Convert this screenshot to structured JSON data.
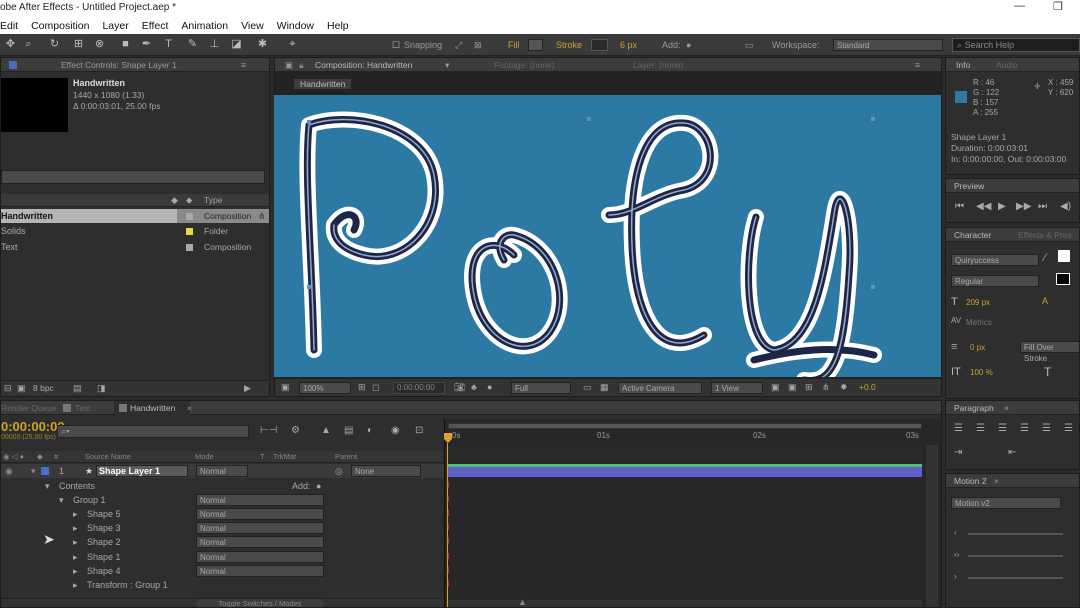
{
  "titlebar": {
    "title": "obe After Effects - Untitled Project.aep *"
  },
  "menu": [
    "Edit",
    "Composition",
    "Layer",
    "Effect",
    "Animation",
    "View",
    "Window",
    "Help"
  ],
  "toolbar": {
    "snapping": "Snapping",
    "fill": "Fill",
    "stroke": "Stroke",
    "stroke_px": "6 px",
    "add": "Add:",
    "workspace_label": "Workspace:",
    "workspace_value": "Standard",
    "search_placeholder": "Search Help"
  },
  "project": {
    "effect_tab": "Effect Controls: Shape Layer 1",
    "comp_name": "Handwritten",
    "comp_res": "1440 x 1080 (1.33)",
    "comp_duration": "Δ 0:00:03:01, 25.00 fps",
    "col_type": "Type",
    "items": [
      {
        "name": "Handwritten",
        "type": "Composition",
        "color": "#a8a8a8"
      },
      {
        "name": "Solids",
        "type": "Folder",
        "color": "#e8d84a"
      },
      {
        "name": "Text",
        "type": "Composition",
        "color": "#a8a8a8"
      }
    ],
    "bpc": "8 bpc"
  },
  "viewer": {
    "comp_tab": "Composition: Handwritten",
    "footage_tab": "Footage: (none)",
    "layer_tab": "Layer: (none)",
    "breadcrumb": "Handwritten",
    "canvas_text": "Poly",
    "canvas_color": "#2c7aa3",
    "zoom": "100%",
    "time": "0:00:00:00",
    "resolution": "Full",
    "camera": "Active Camera",
    "views": "1 View",
    "exposure": "+0.0"
  },
  "info": {
    "tab": "Info",
    "audio_tab": "Audio",
    "r": "R : 46",
    "g": "G : 122",
    "b": "B : 157",
    "a": "A : 255",
    "x": "X : 459",
    "y": "Y : 620",
    "color": "#2e7a9d",
    "layer": "Shape Layer 1",
    "duration": "Duration: 0:00:03:01",
    "inout": "In: 0:00:00:00, Out: 0:00:03:00"
  },
  "preview": {
    "tab": "Preview"
  },
  "character": {
    "tab": "Character",
    "effects_tab": "Effects & Pres",
    "font": "Quiryuccess",
    "style": "Regular",
    "size": "209 px",
    "tracking": "Metrics",
    "stroke_px": "0 px",
    "stroke_mode": "Fill Over Stroke",
    "scale": "100 %"
  },
  "paragraph": {
    "tab": "Paragraph"
  },
  "motion2": {
    "tab": "Motion 2",
    "dropdown": "Motion v2"
  },
  "timeline": {
    "tabs": [
      "Render Queue",
      "Text",
      "Handwritten"
    ],
    "time": "0:00:00:00",
    "frames": "00000 (25.00 fps)",
    "col_source": "Source Name",
    "col_mode": "Mode",
    "col_t": "T",
    "col_trkmat": "TrkMat",
    "col_parent": "Parent",
    "layer_num": "1",
    "layer_name": "Shape Layer 1",
    "layer_mode": "Normal",
    "layer_parent": "None",
    "contents": "Contents",
    "add": "Add:",
    "group": "Group 1",
    "shapes": [
      "Shape 5",
      "Shape 3",
      "Shape 2",
      "Shape 1",
      "Shape 4"
    ],
    "shape_mode": "Normal",
    "transform": "Transform : Group 1",
    "ruler": [
      "0s",
      "01s",
      "02s",
      "03s"
    ],
    "toggle": "Toggle Switches / Modes"
  }
}
